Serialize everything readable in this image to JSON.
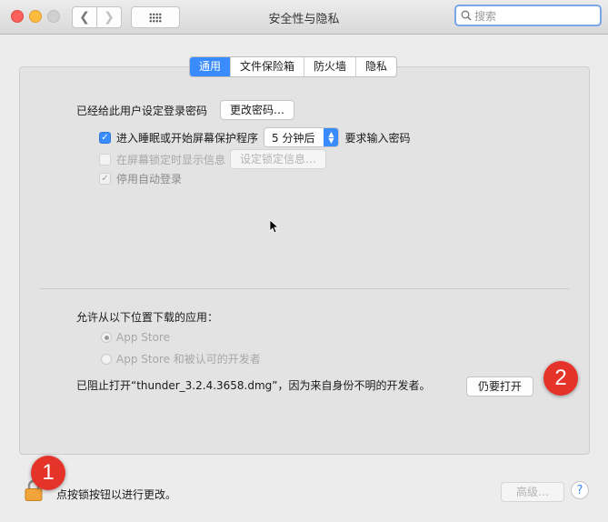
{
  "window": {
    "title": "安全性与隐私"
  },
  "toolbar": {
    "search_placeholder": "搜索"
  },
  "tabs": [
    {
      "label": "通用",
      "active": true
    },
    {
      "label": "文件保险箱",
      "active": false
    },
    {
      "label": "防火墙",
      "active": false
    },
    {
      "label": "隐私",
      "active": false
    }
  ],
  "general": {
    "password_text": "已经给此用户设定登录密码",
    "change_password_button": "更改密码…",
    "require_password": {
      "checked": true,
      "label_before": "进入睡眠或开始屏幕保护程序",
      "delay_value": "5 分钟后",
      "label_after": "要求输入密码"
    },
    "show_message": {
      "checked": false,
      "label": "在屏幕锁定时显示信息",
      "button": "设定锁定信息…"
    },
    "disable_auto_login": {
      "checked": true,
      "label": "停用自动登录"
    }
  },
  "downloads": {
    "heading": "允许从以下位置下载的应用：",
    "options": [
      {
        "label": "App Store",
        "selected": true
      },
      {
        "label": "App Store 和被认可的开发者",
        "selected": false
      }
    ],
    "blocked_message": "已阻止打开“thunder_3.2.4.3658.dmg”，因为来自身份不明的开发者。",
    "open_anyway_button": "仍要打开"
  },
  "footer": {
    "lock_text": "点按锁按钮以进行更改。",
    "advanced_button": "高级…",
    "help_label": "?"
  },
  "annotations": {
    "badge1": "1",
    "badge2": "2"
  },
  "colors": {
    "accent": "#3a8bfd",
    "badge": "#e6332a"
  }
}
